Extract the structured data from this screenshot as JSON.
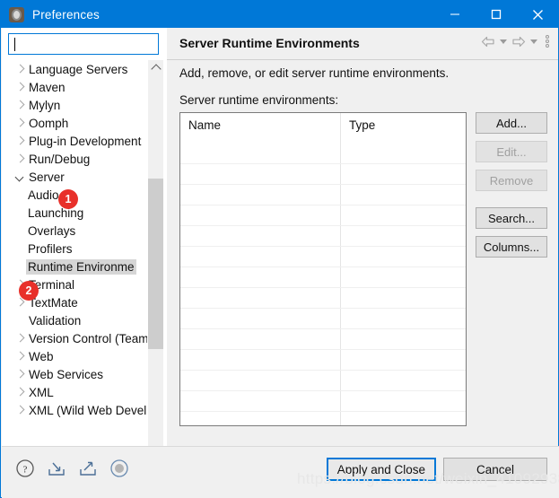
{
  "window": {
    "title": "Preferences",
    "icon": "preferences-gear-icon",
    "accent_color": "#0078d7",
    "controls": {
      "minimize": "–",
      "maximize": "□",
      "close": "✕"
    }
  },
  "sidebar": {
    "search": {
      "value": "",
      "placeholder": ""
    },
    "tree": [
      {
        "label": "Language Servers",
        "state": "collapsed",
        "level": 0
      },
      {
        "label": "Maven",
        "state": "collapsed",
        "level": 0
      },
      {
        "label": "Mylyn",
        "state": "collapsed",
        "level": 0
      },
      {
        "label": "Oomph",
        "state": "collapsed",
        "level": 0
      },
      {
        "label": "Plug-in Development",
        "state": "collapsed",
        "level": 0
      },
      {
        "label": "Run/Debug",
        "state": "collapsed",
        "level": 0
      },
      {
        "label": "Server",
        "state": "expanded",
        "level": 0
      },
      {
        "label": "Audio",
        "state": "leaf",
        "level": 1
      },
      {
        "label": "Launching",
        "state": "leaf",
        "level": 1
      },
      {
        "label": "Overlays",
        "state": "leaf",
        "level": 1
      },
      {
        "label": "Profilers",
        "state": "leaf",
        "level": 1
      },
      {
        "label": "Runtime Environme",
        "state": "leaf",
        "level": 1,
        "selected": true
      },
      {
        "label": "Terminal",
        "state": "collapsed",
        "level": 0
      },
      {
        "label": "TextMate",
        "state": "collapsed",
        "level": 0
      },
      {
        "label": "Validation",
        "state": "leaf",
        "level": 0
      },
      {
        "label": "Version Control (Team",
        "state": "collapsed",
        "level": 0
      },
      {
        "label": "Web",
        "state": "collapsed",
        "level": 0
      },
      {
        "label": "Web Services",
        "state": "collapsed",
        "level": 0
      },
      {
        "label": "XML",
        "state": "collapsed",
        "level": 0
      },
      {
        "label": "XML (Wild Web Devel",
        "state": "collapsed",
        "level": 0
      }
    ],
    "badges": [
      {
        "number": "1",
        "color": "#e8302a",
        "target": "Server"
      },
      {
        "number": "2",
        "color": "#e8302a",
        "target": "Runtime Environme"
      }
    ]
  },
  "main": {
    "title": "Server Runtime Environments",
    "description": "Add, remove, or edit server runtime environments.",
    "list_label": "Server runtime environments:",
    "header_icons": [
      "back-arrow-icon",
      "back-dropdown-icon",
      "forward-arrow-icon",
      "forward-dropdown-icon",
      "view-menu-icon"
    ],
    "table": {
      "columns": [
        "Name",
        "Type"
      ],
      "rows": []
    },
    "buttons": [
      {
        "label": "Add...",
        "enabled": true
      },
      {
        "label": "Edit...",
        "enabled": false
      },
      {
        "label": "Remove",
        "enabled": false
      },
      {
        "label": "Search...",
        "enabled": true
      },
      {
        "label": "Columns...",
        "enabled": true
      }
    ]
  },
  "footer": {
    "icons": [
      "help-icon",
      "import-icon",
      "export-icon",
      "restore-defaults-icon"
    ],
    "apply_label": "Apply and Close",
    "cancel_label": "Cancel"
  },
  "watermark": "https://blog.csdn.net/weixin_41092938"
}
